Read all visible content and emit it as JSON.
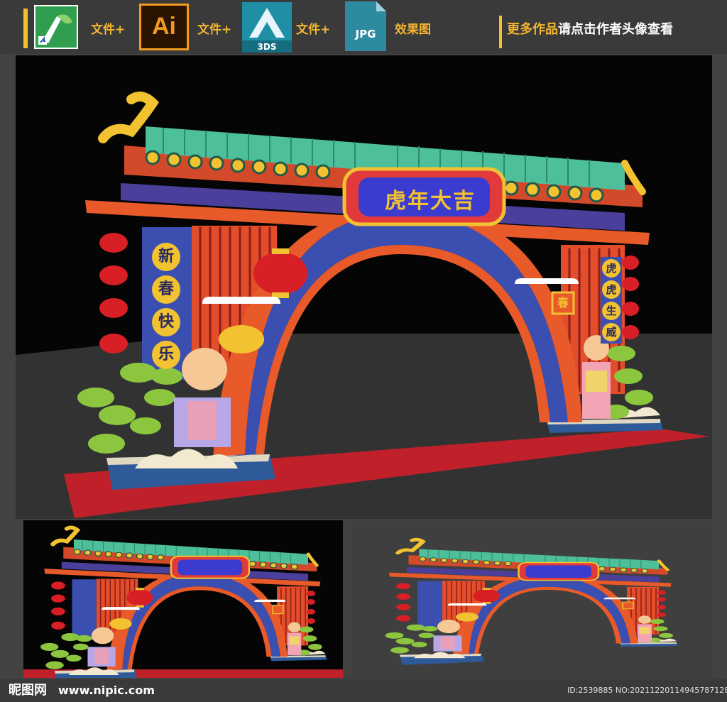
{
  "toolbar": {
    "file_a": "文件+",
    "file_b": "文件+",
    "file_c": "文件+",
    "ai_label": "Ai",
    "max_label": "3DS",
    "jpg_label": "JPG",
    "effect": "效果图",
    "promo_highlight": "更多作品",
    "promo_rest": "请点击作者头像查看"
  },
  "scene": {
    "sign_text": "虎年大吉",
    "left_column_text": [
      "新",
      "春",
      "快",
      "乐"
    ],
    "right_column_text": [
      "虎",
      "虎",
      "生",
      "威"
    ],
    "badge_text": "春"
  },
  "footer": {
    "site_logo": "昵图网",
    "site_url": "www.nipic.com",
    "image_id": "ID:2539885 NO:20211220114945787128"
  },
  "colors": {
    "accent": "#f2b632",
    "background": "#424242",
    "scene_dark": "#050505",
    "carpet": "#c0202a",
    "tile_green": "#4dbf9a",
    "arch_orange": "#e85a2a",
    "arch_blue": "#3b4fb0"
  }
}
